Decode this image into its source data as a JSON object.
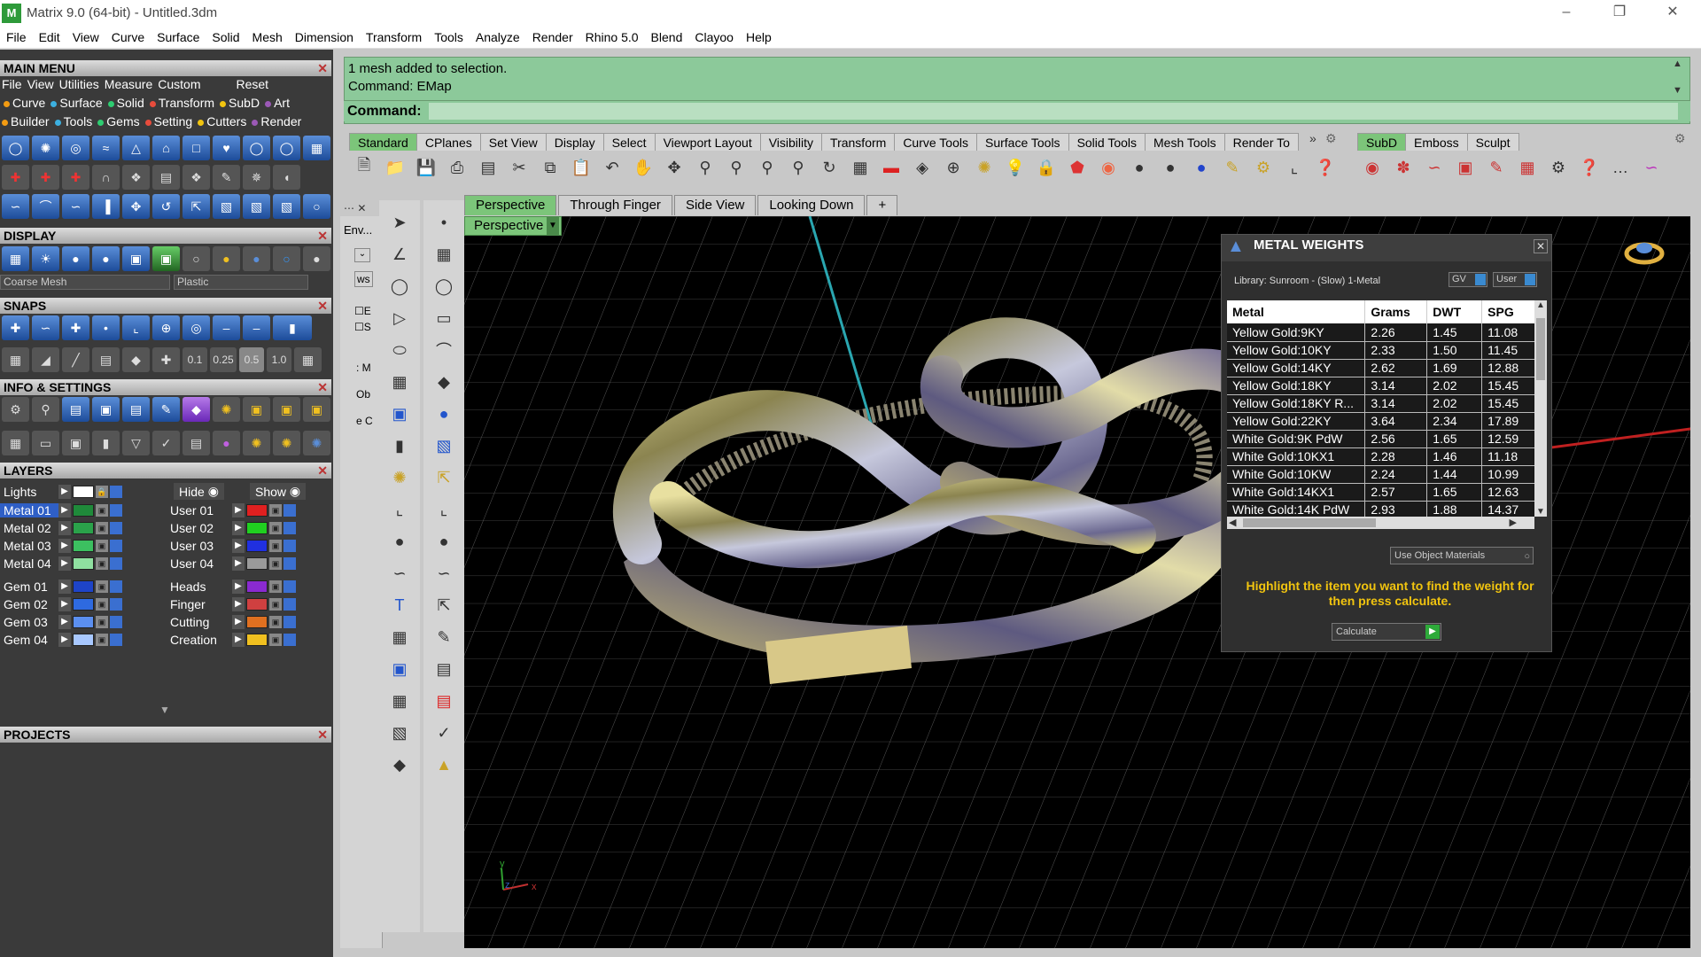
{
  "window": {
    "title": "Matrix 9.0 (64-bit) - Untitled.3dm",
    "icon": "matrix-app-icon"
  },
  "menubar": [
    "File",
    "Edit",
    "View",
    "Curve",
    "Surface",
    "Solid",
    "Mesh",
    "Dimension",
    "Transform",
    "Tools",
    "Analyze",
    "Render",
    "Rhino 5.0",
    "Blend",
    "Clayoo",
    "Help"
  ],
  "main_menu": {
    "header": "MAIN MENU",
    "row1": [
      "File",
      "View",
      "Utilities",
      "Measure",
      "Custom",
      "Reset"
    ],
    "row2": [
      "Curve",
      "Surface",
      "Solid",
      "Transform",
      "SubD",
      "Art"
    ],
    "row3": [
      "Builder",
      "Tools",
      "Gems",
      "Setting",
      "Cutters",
      "Render"
    ]
  },
  "display": {
    "header": "DISPLAY",
    "mesh_select": "Coarse Mesh",
    "material_select": "Plastic"
  },
  "snaps": {
    "header": "SNAPS",
    "values": [
      "0.1",
      "0.25",
      "0.5",
      "1.0"
    ]
  },
  "info_settings": {
    "header": "INFO & SETTINGS"
  },
  "layers": {
    "header": "LAYERS",
    "lights": "Lights",
    "hide": "Hide",
    "show": "Show",
    "left": [
      {
        "name": "Metal 01",
        "color": "#1f8a3a"
      },
      {
        "name": "Metal 02",
        "color": "#2aa24a"
      },
      {
        "name": "Metal 03",
        "color": "#3cc060"
      },
      {
        "name": "Metal 04",
        "color": "#8fe0a0"
      },
      {
        "name": "Gem 01",
        "color": "#1e44c8"
      },
      {
        "name": "Gem 02",
        "color": "#2e6ae0"
      },
      {
        "name": "Gem 03",
        "color": "#5b8ff0"
      },
      {
        "name": "Gem 04",
        "color": "#a8c8ff"
      }
    ],
    "right": [
      {
        "name": "User 01",
        "color": "#e02020"
      },
      {
        "name": "User 02",
        "color": "#20d020"
      },
      {
        "name": "User 03",
        "color": "#2030e0"
      },
      {
        "name": "User 04",
        "color": "#9a9a9a"
      },
      {
        "name": "Heads",
        "color": "#8a2ad0"
      },
      {
        "name": "Finger",
        "color": "#d04040"
      },
      {
        "name": "Cutting",
        "color": "#e07020"
      },
      {
        "name": "Creation",
        "color": "#f0c020"
      }
    ]
  },
  "projects": {
    "header": "PROJECTS"
  },
  "command": {
    "line1": "1 mesh added to selection.",
    "line2": "Command: EMap",
    "prompt": "Command:"
  },
  "toolbar_tabs": [
    "Standard",
    "CPlanes",
    "Set View",
    "Display",
    "Select",
    "Viewport Layout",
    "Visibility",
    "Transform",
    "Curve Tools",
    "Surface Tools",
    "Solid Tools",
    "Mesh Tools",
    "Render To"
  ],
  "right_tabs": [
    "SubD",
    "Emboss",
    "Sculpt"
  ],
  "side_labels": [
    "Env...",
    "ws",
    "E",
    "S",
    ": M",
    "Ob",
    "e C"
  ],
  "view_tabs": [
    "Perspective",
    "Through Finger",
    "Side View",
    "Looking Down",
    "+"
  ],
  "viewport": {
    "label": "Perspective",
    "axis_x": "x",
    "axis_y": "y",
    "axis_z": "z"
  },
  "metal_weights": {
    "title": "METAL WEIGHTS",
    "library": "Library: Sunroom - (Slow) 1-Metal",
    "gv": "GV",
    "user": "User",
    "columns": [
      "Metal",
      "Grams",
      "DWT",
      "SPG"
    ],
    "rows": [
      [
        "Yellow Gold:9KY",
        "2.26",
        "1.45",
        "11.08"
      ],
      [
        "Yellow Gold:10KY",
        "2.33",
        "1.50",
        "11.45"
      ],
      [
        "Yellow Gold:14KY",
        "2.62",
        "1.69",
        "12.88"
      ],
      [
        "Yellow Gold:18KY",
        "3.14",
        "2.02",
        "15.45"
      ],
      [
        "Yellow Gold:18KY R...",
        "3.14",
        "2.02",
        "15.45"
      ],
      [
        "Yellow Gold:22KY",
        "3.64",
        "2.34",
        "17.89"
      ],
      [
        "White Gold:9K PdW",
        "2.56",
        "1.65",
        "12.59"
      ],
      [
        "White Gold:10KX1",
        "2.28",
        "1.46",
        "11.18"
      ],
      [
        "White Gold:10KW",
        "2.24",
        "1.44",
        "10.99"
      ],
      [
        "White Gold:14KX1",
        "2.57",
        "1.65",
        "12.63"
      ],
      [
        "White Gold:14K PdW",
        "2.93",
        "1.88",
        "14.37"
      ]
    ],
    "use_object_materials": "Use Object Materials",
    "hint": "Highlight the item you want to find the weight for then press calculate.",
    "calculate": "Calculate"
  }
}
